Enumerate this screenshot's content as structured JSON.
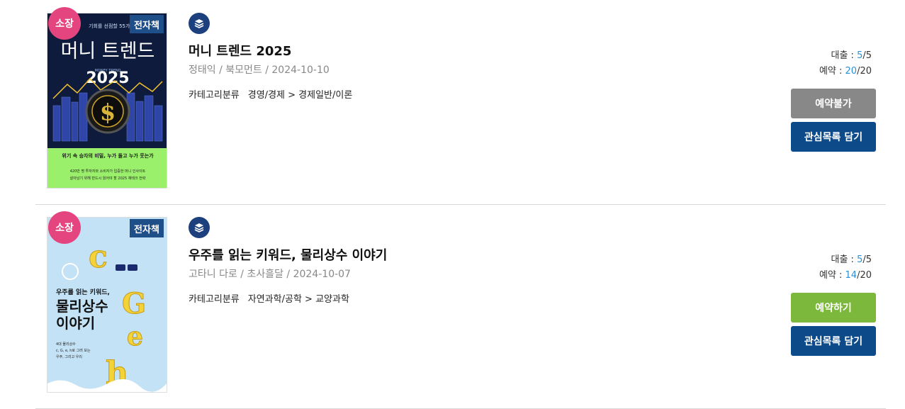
{
  "items": [
    {
      "badge_own": "소장",
      "badge_ebook": "전자책",
      "title": "머니 트렌드 2025",
      "meta": "정태익 / 북모먼트 / 2024-10-10",
      "category_label": "카테고리분류",
      "category_value": "경영/경제 > 경제일반/이론",
      "loan_label": "대출 : ",
      "loan_current": "5",
      "loan_total": "/5",
      "reserve_label": "예약 : ",
      "reserve_current": "20",
      "reserve_total": "/20",
      "action_button": "예약불가",
      "wishlist_button": "관심목록 담기",
      "cover": {
        "top_line": "기회를 선점할 55가지",
        "title": "머니 트렌드",
        "sub": "MONEY        TREND",
        "year": "2025",
        "tagline": "위기 속 승자의 비밀, 누가 돌고 누가 웃는가",
        "desc1": "420만 명 투자자와 소비자가 입증한 머니 인사이트",
        "desc2": "살아남기 위해 반드시 읽어야 할 2025 재테크 전략"
      }
    },
    {
      "badge_own": "소장",
      "badge_ebook": "전자책",
      "title": "우주를 읽는 키워드, 물리상수 이야기",
      "meta": "고타니 다로 / 초사흘달 / 2024-10-07",
      "category_label": "카테고리분류",
      "category_value": "자연과학/공학 > 교양과학",
      "loan_label": "대출 : ",
      "loan_current": "5",
      "loan_total": "/5",
      "reserve_label": "예약 : ",
      "reserve_current": "14",
      "reserve_total": "/20",
      "action_button": "예약하기",
      "wishlist_button": "관심목록 담기",
      "cover": {
        "line1": "우주를 읽는 키워드,",
        "line2": "물리상수",
        "line3": "이야기",
        "small1": "4대 물리상수",
        "small2": "c, G, e, h로 그려 보는",
        "small3": "우주, 그리고 우리",
        "letters": [
          "c",
          "G",
          "e",
          "h"
        ]
      }
    }
  ],
  "colors": {
    "badge_own": "#e5457f",
    "badge_ebook": "#1f4f88",
    "btn_disabled": "#888888",
    "btn_reserve": "#7cb83b",
    "btn_wishlist": "#0c4a8a",
    "count_accent": "#2b8fd6"
  }
}
